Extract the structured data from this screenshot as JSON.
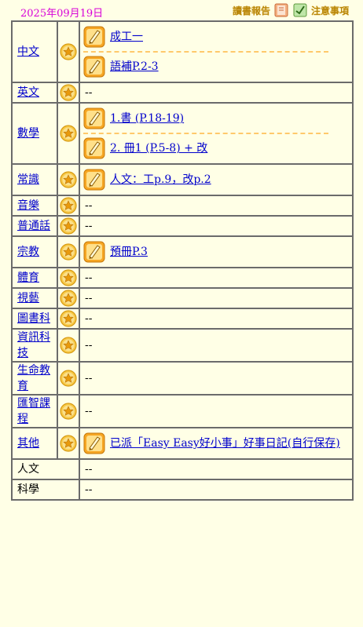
{
  "header": {
    "date": "2025年09月19日",
    "reading_report_label": "讀書報告",
    "notice_label": "注意事項"
  },
  "rows": [
    {
      "subject": "中文",
      "link": true,
      "items": [
        "成工一",
        "語補P.2-3"
      ]
    },
    {
      "subject": "英文",
      "link": true,
      "items": [],
      "empty": "--"
    },
    {
      "subject": "數學",
      "link": true,
      "items": [
        "1.書 (P.18-19)",
        "2. 冊1 (P.5-8) + 改"
      ]
    },
    {
      "subject": "常識",
      "link": true,
      "items": [
        "人文：工p.9，改p.2"
      ]
    },
    {
      "subject": "音樂",
      "link": true,
      "items": [],
      "empty": "--"
    },
    {
      "subject": "普通話",
      "link": true,
      "items": [],
      "empty": "--"
    },
    {
      "subject": "宗教",
      "link": true,
      "items": [
        "預冊P.3"
      ]
    },
    {
      "subject": "體育",
      "link": true,
      "items": [],
      "empty": "--"
    },
    {
      "subject": "視藝",
      "link": true,
      "items": [],
      "empty": "--"
    },
    {
      "subject": "圖書科",
      "link": true,
      "items": [],
      "empty": "--"
    },
    {
      "subject": "資訊科技",
      "link": true,
      "items": [],
      "empty": "--"
    },
    {
      "subject": "生命教育",
      "link": true,
      "items": [],
      "empty": "--"
    },
    {
      "subject": "匯智課程",
      "link": true,
      "items": [],
      "empty": "--"
    },
    {
      "subject": "其他",
      "link": true,
      "items": [
        "已派「Easy Easy好小事」好事日記(自行保存)"
      ]
    },
    {
      "subject": "人文",
      "link": false,
      "items": [],
      "empty": "--"
    },
    {
      "subject": "科學",
      "link": false,
      "items": [],
      "empty": "--"
    }
  ],
  "colors": {
    "date": "#D800D8",
    "link": "#0000CC",
    "background": "#FFFFE6",
    "divider": "#FFC96B"
  }
}
